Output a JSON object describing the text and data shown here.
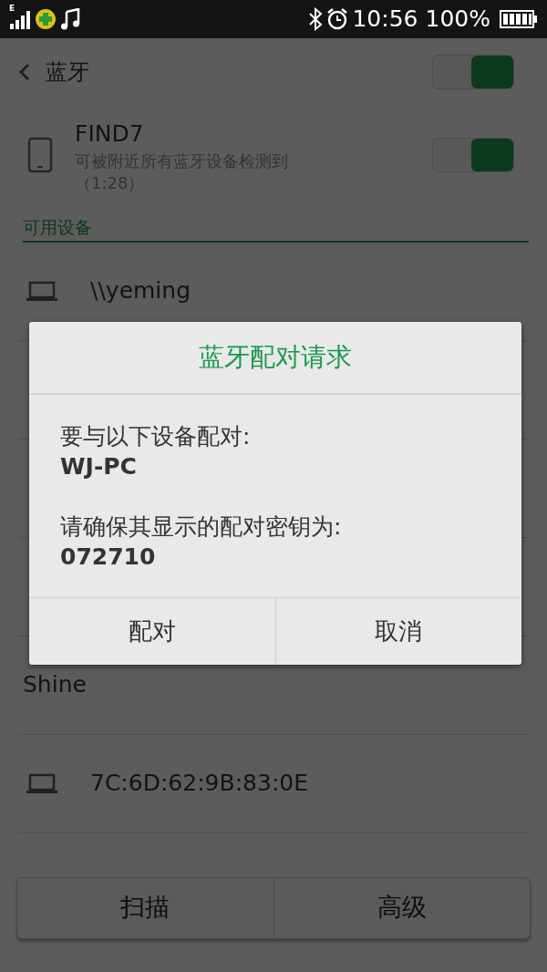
{
  "status_bar": {
    "network": "E",
    "time": "10:56",
    "battery": "100%"
  },
  "header": {
    "title": "蓝牙",
    "on": true
  },
  "this_device": {
    "name": "FIND7",
    "subtitle": "可被附近所有蓝牙设备检测到（1:28）",
    "on": true
  },
  "section_title": "可用设备",
  "devices": [
    {
      "name": "\\\\yeming",
      "kind": "laptop"
    },
    {
      "name": "Shine",
      "kind": "plain"
    },
    {
      "name": "7C:6D:62:9B:83:0E",
      "kind": "laptop"
    }
  ],
  "bottom_buttons": [
    "扫描",
    "高级"
  ],
  "dialog": {
    "title": "蓝牙配对请求",
    "lines": [
      {
        "text": "要与以下设备配对:",
        "kind": "label"
      },
      {
        "text": "WJ-PC",
        "kind": "value"
      },
      {
        "text": "请确保其显示的配对密钥为:",
        "kind": "label"
      },
      {
        "text": "072710",
        "kind": "value"
      }
    ],
    "buttons": [
      "配对",
      "取消"
    ]
  }
}
